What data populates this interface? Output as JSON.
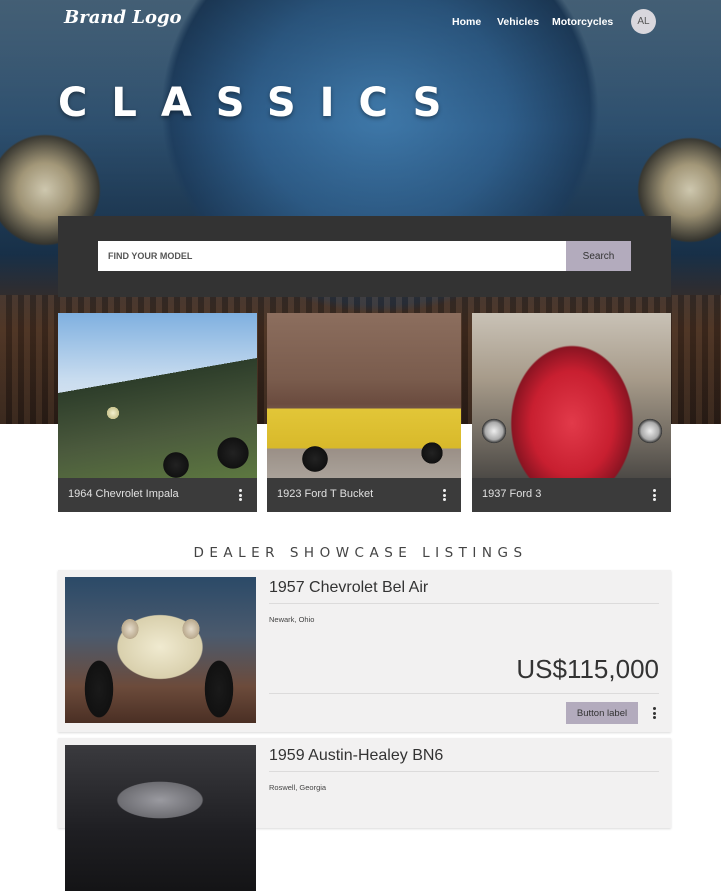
{
  "nav": {
    "brand": "Brand Logo",
    "links": [
      "Home",
      "Vehicles",
      "Motorcycles"
    ],
    "avatar": "AL"
  },
  "hero": {
    "title": "CLASSICS",
    "search_placeholder": "FIND YOUR MODEL",
    "search_button": "Search"
  },
  "featured": [
    {
      "title": "1964 Chevrolet Impala"
    },
    {
      "title": "1923 Ford T Bucket"
    },
    {
      "title": "1937 Ford 3"
    }
  ],
  "section": {
    "title": "DEALER SHOWCASE LISTINGS"
  },
  "listings": [
    {
      "title": "1957 Chevrolet Bel Air",
      "location": "Newark, Ohio",
      "price": "US$115,000",
      "button": "Button label"
    },
    {
      "title": "1959 Austin-Healey BN6",
      "location": "Roswell, Georgia"
    }
  ],
  "colors": {
    "panel_dark": "#333333",
    "button_lavender": "#b3abbd",
    "card_footer": "#3b3b3b",
    "listing_bg": "#f2f1f1"
  }
}
